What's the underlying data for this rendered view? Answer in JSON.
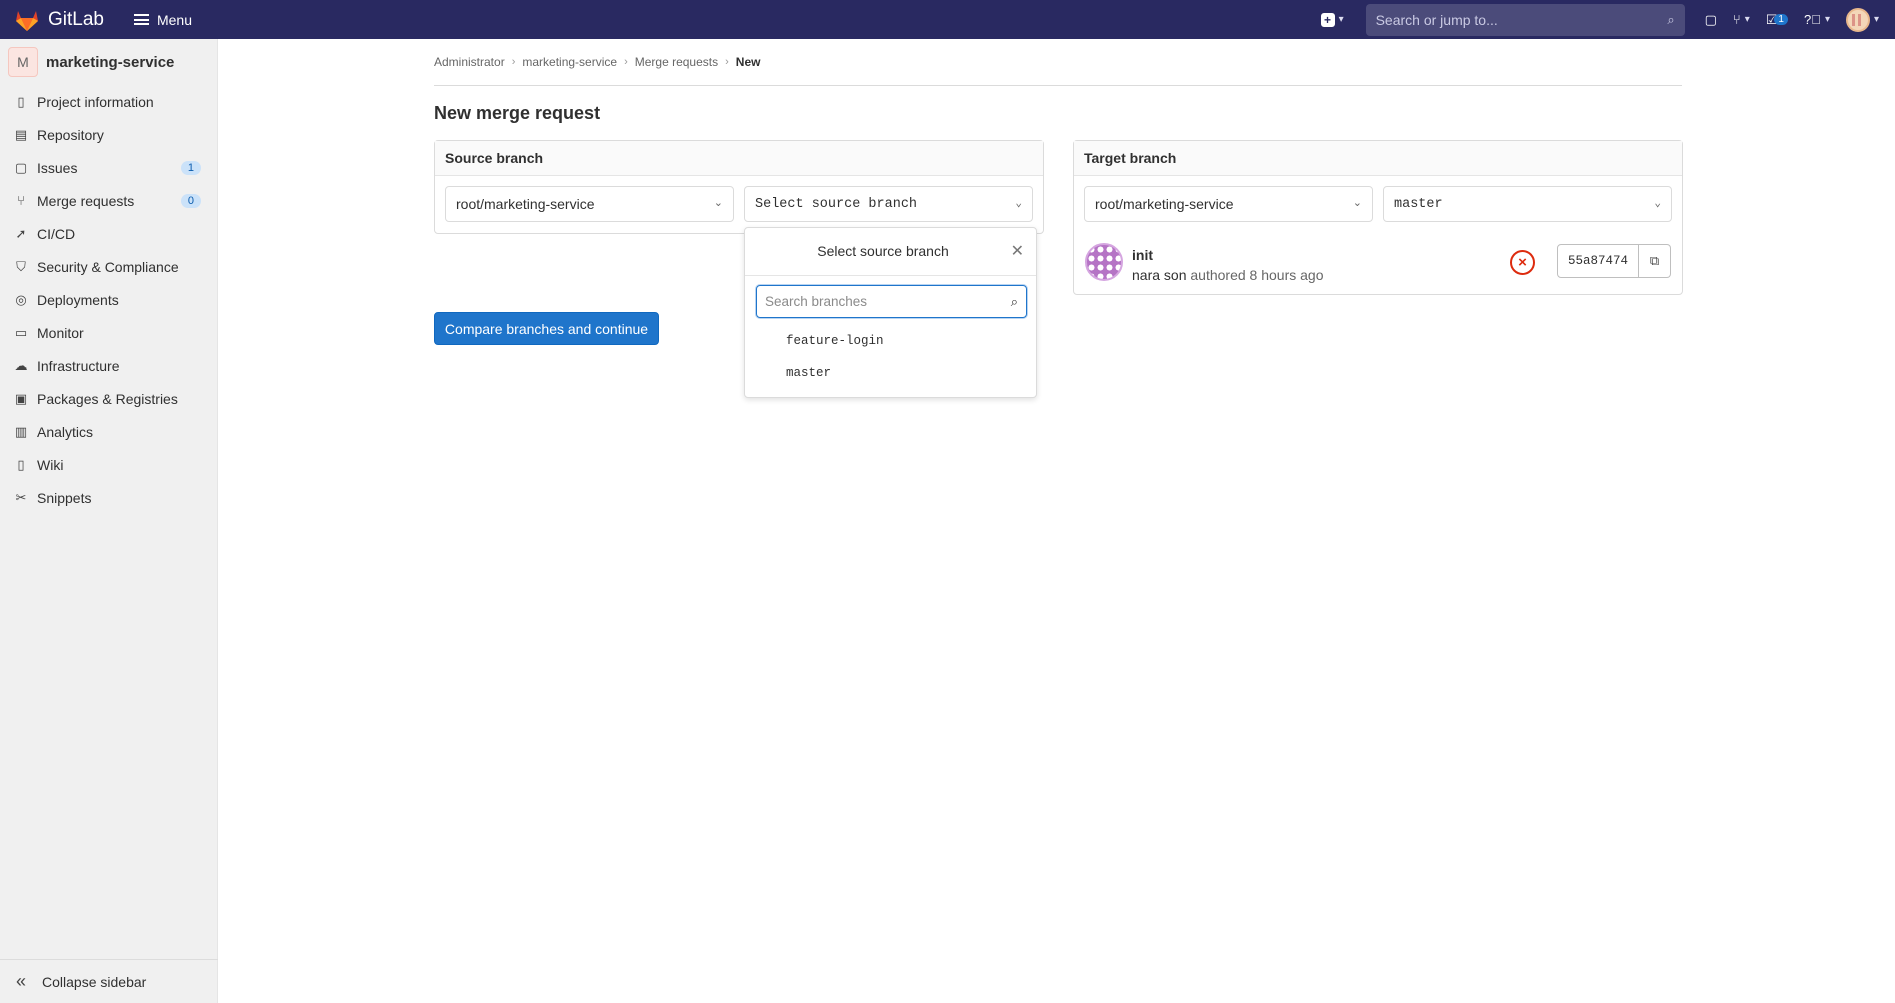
{
  "app": {
    "name": "GitLab",
    "menu_label": "Menu"
  },
  "topbar": {
    "search_placeholder": "Search or jump to...",
    "todo_count": "1"
  },
  "sidebar": {
    "project_initial": "M",
    "project_name": "marketing-service",
    "items": [
      {
        "label": "Project information",
        "icon": "project-info-icon"
      },
      {
        "label": "Repository",
        "icon": "repository-icon"
      },
      {
        "label": "Issues",
        "icon": "issues-icon",
        "badge": "1"
      },
      {
        "label": "Merge requests",
        "icon": "merge-request-icon",
        "badge": "0"
      },
      {
        "label": "CI/CD",
        "icon": "rocket-icon"
      },
      {
        "label": "Security & Compliance",
        "icon": "shield-icon"
      },
      {
        "label": "Deployments",
        "icon": "deployments-icon"
      },
      {
        "label": "Monitor",
        "icon": "monitor-icon"
      },
      {
        "label": "Infrastructure",
        "icon": "cloud-icon"
      },
      {
        "label": "Packages & Registries",
        "icon": "package-icon"
      },
      {
        "label": "Analytics",
        "icon": "chart-icon"
      },
      {
        "label": "Wiki",
        "icon": "book-icon"
      },
      {
        "label": "Snippets",
        "icon": "scissors-icon"
      }
    ],
    "collapse_label": "Collapse sidebar"
  },
  "breadcrumb": [
    "Administrator",
    "marketing-service",
    "Merge requests",
    "New"
  ],
  "page_title": "New merge request",
  "source": {
    "heading": "Source branch",
    "project": "root/marketing-service",
    "branch_placeholder": "Select source branch",
    "popover": {
      "title": "Select source branch",
      "search_placeholder": "Search branches",
      "branches": [
        "feature-login",
        "master"
      ]
    }
  },
  "target": {
    "heading": "Target branch",
    "project": "root/marketing-service",
    "branch": "master",
    "commit": {
      "title": "init",
      "author": "nara son",
      "meta": "authored 8 hours ago",
      "sha": "55a87474"
    }
  },
  "compare_button": "Compare branches and continue"
}
